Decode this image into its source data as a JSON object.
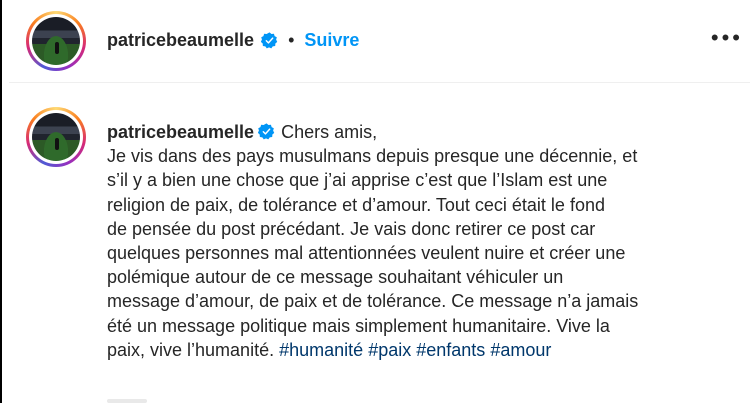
{
  "header": {
    "username": "patricebeaumelle",
    "separator": "•",
    "follow_label": "Suivre",
    "more_label": "•••"
  },
  "post": {
    "username": "patricebeaumelle",
    "caption_lines": [
      "Chers amis,",
      "Je vis dans des pays musulmans depuis presque une décennie, et",
      "s’il y a bien une chose que j’ai apprise c’est que l’Islam est une",
      "religion de paix, de tolérance et d’amour. Tout ceci était le fond",
      "de pensée du post précédant. Je vais donc retirer ce post car",
      "quelques personnes mal attentionnées veulent nuire et créer une",
      "polémique autour de ce message souhaitant véhiculer un",
      "message d’amour, de paix et de tolérance. Ce message n’a jamais",
      "été un message politique mais simplement humanitaire. Vive la",
      "paix, vive l’humanité."
    ],
    "hashtags": [
      "#humanité",
      "#paix",
      "#enfants",
      "#amour"
    ]
  },
  "colors": {
    "link_blue": "#0095f6",
    "hashtag_blue": "#00376b",
    "verified_blue": "#0095f6",
    "text": "#262626"
  }
}
